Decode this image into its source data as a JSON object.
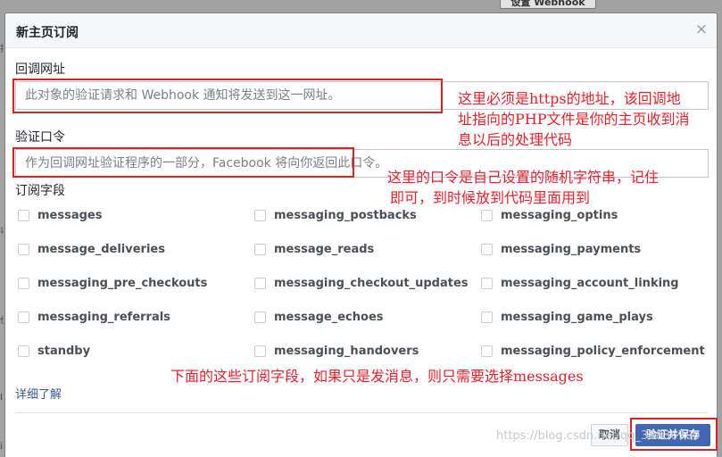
{
  "background": {
    "top_button_label": "设置 Webhook",
    "edge_marks": [
      "排",
      "以",
      "价",
      "I",
      "i"
    ]
  },
  "dialog": {
    "title": "新主页订阅",
    "close_glyph": "×",
    "callback_url": {
      "label": "回调网址",
      "value": "",
      "placeholder": "此对象的验证请求和 Webhook 通知将发送到这一网址。"
    },
    "verify_token": {
      "label": "验证口令",
      "value": "",
      "placeholder": "作为回调网址验证程序的一部分，Facebook 将向你返回此口令。"
    },
    "fields_label": "订阅字段",
    "fields": [
      [
        "messages",
        "messaging_postbacks",
        "messaging_optins"
      ],
      [
        "message_deliveries",
        "message_reads",
        "messaging_payments"
      ],
      [
        "messaging_pre_checkouts",
        "messaging_checkout_updates",
        "messaging_account_linking"
      ],
      [
        "messaging_referrals",
        "message_echoes",
        "messaging_game_plays"
      ],
      [
        "standby",
        "messaging_handovers",
        "messaging_policy_enforcement"
      ]
    ],
    "learn_more": "详细了解",
    "cancel_label": "取消",
    "save_label": "验证并保存"
  },
  "annotations": {
    "note_url_line1": "这里必须是https的地址，该回调地",
    "note_url_line2": "址指向的PHP文件是你的主页收到消",
    "note_url_line3": "息以后的处理代码",
    "note_token_line1": "这里的口令是自己设置的随机字符串，记住",
    "note_token_line2": "即可，到时候放到代码里面用到",
    "note_fields": "下面的这些订阅字段，如果只是发消息，则只需要选择messages",
    "color": "#e8202a"
  },
  "watermark": "https://blog.csdn.net/qq_38836700"
}
